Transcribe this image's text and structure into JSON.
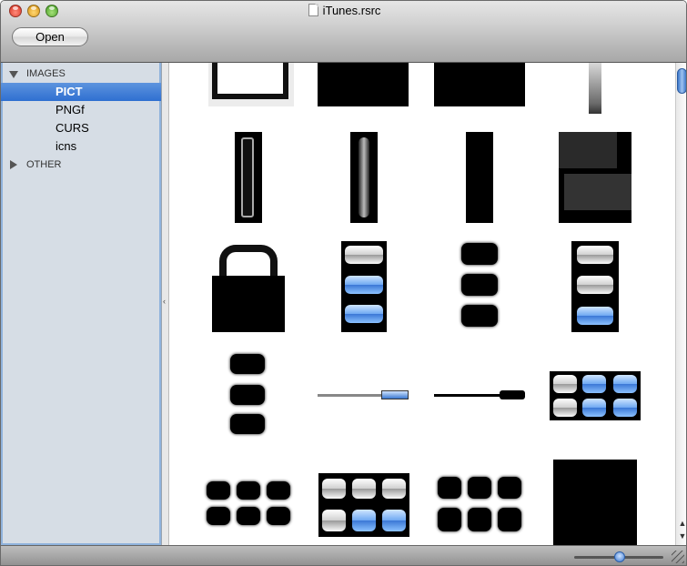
{
  "window": {
    "title": "iTunes.rsrc"
  },
  "toolbar": {
    "open_label": "Open"
  },
  "sidebar": {
    "groups": [
      {
        "label": "IMAGES",
        "expanded": true
      },
      {
        "label": "OTHER",
        "expanded": false
      }
    ],
    "items": [
      {
        "label": "PICT",
        "selected": true
      },
      {
        "label": "PNGf",
        "selected": false
      },
      {
        "label": "CURS",
        "selected": false
      },
      {
        "label": "icns",
        "selected": false
      }
    ]
  },
  "icons": {
    "close": "close-button-icon",
    "minimize": "minimize-button-icon",
    "zoom": "zoom-button-icon",
    "document": "document-icon",
    "disclosure_open": "triangle-down-icon",
    "disclosure_closed": "triangle-right-icon",
    "resize": "resize-grip-icon"
  },
  "colors": {
    "selection": "#3b78d6",
    "sidebar_bg": "#d6dde5",
    "accent_blue": "#6ea8f2"
  },
  "zoom_slider": {
    "value_fraction": 0.5
  }
}
